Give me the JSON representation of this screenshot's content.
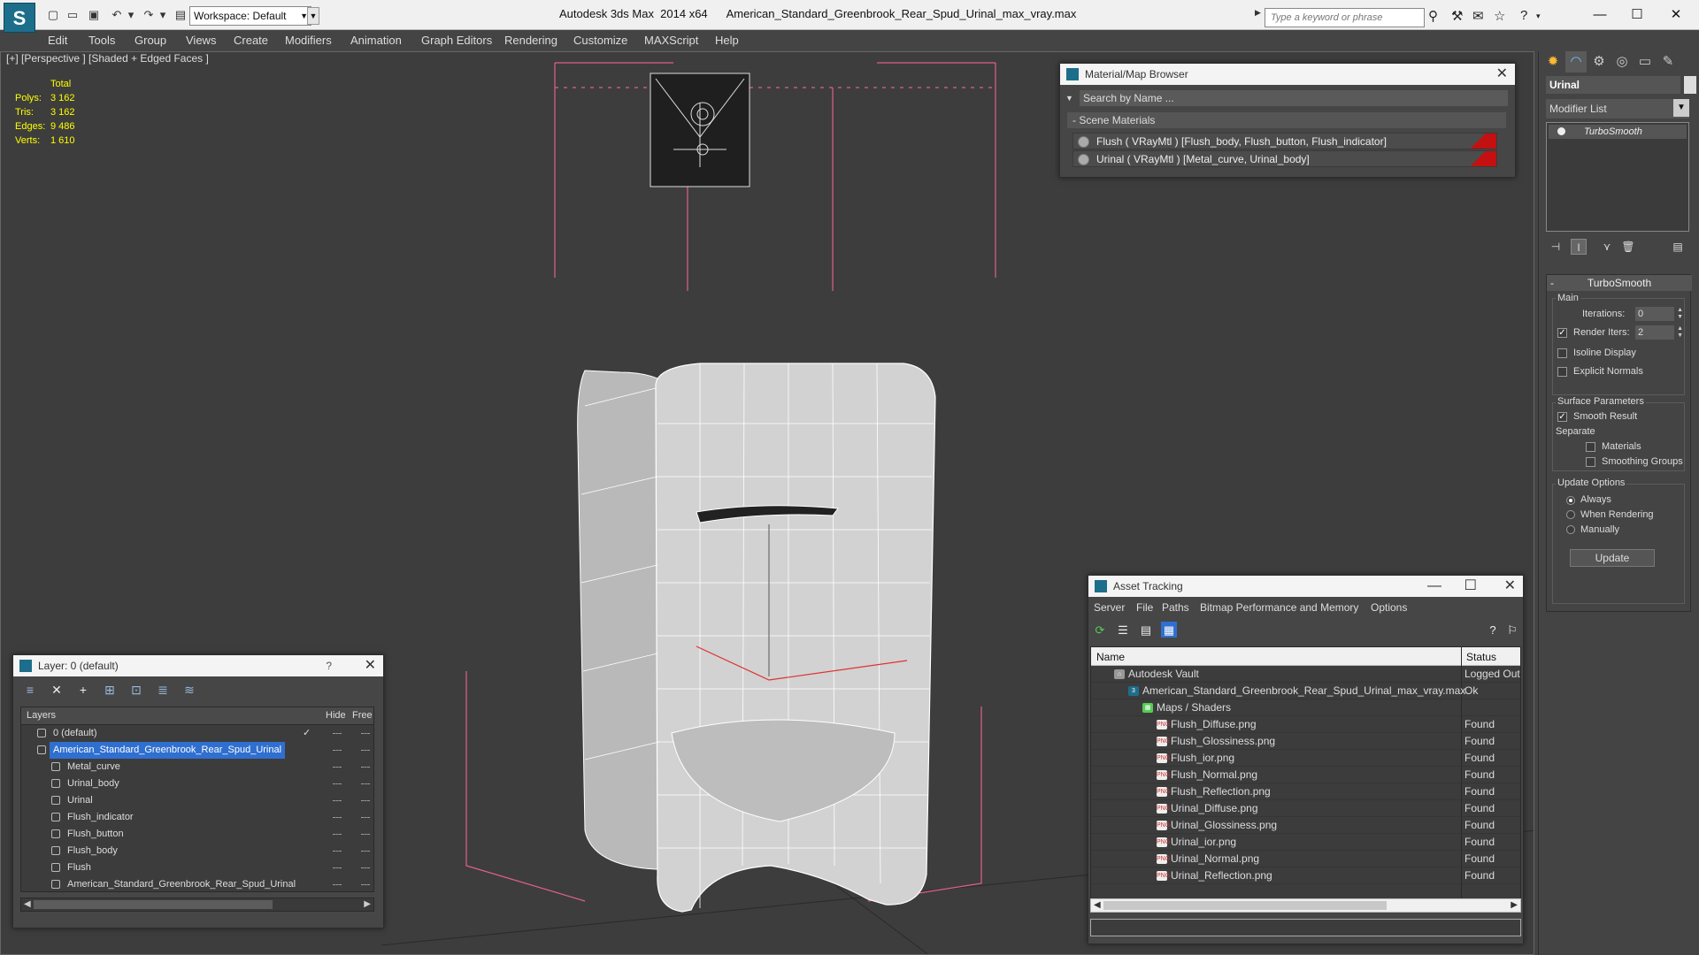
{
  "titlebar": {
    "app_title": "Autodesk 3ds Max  2014 x64      American_Standard_Greenbrook_Rear_Spud_Urinal_max_vray.max",
    "workspace": "Workspace: Default",
    "search_placeholder": "Type a keyword or phrase"
  },
  "menu": [
    "Edit",
    "Tools",
    "Group",
    "Views",
    "Create",
    "Modifiers",
    "Animation",
    "Graph Editors",
    "Rendering",
    "Customize",
    "MAXScript",
    "Help"
  ],
  "viewport": {
    "label": "[+] [Perspective ] [Shaded + Edged Faces ]",
    "stats": {
      "header": "Total",
      "rows": [
        {
          "label": "Polys:",
          "value": "3 162"
        },
        {
          "label": "Tris:",
          "value": "3 162"
        },
        {
          "label": "Edges:",
          "value": "9 486"
        },
        {
          "label": "Verts:",
          "value": "1 610"
        }
      ]
    },
    "colors": {
      "background": "#3d3d3d",
      "model": "#cfcfcf",
      "wire": "#ffffff",
      "bbox": "#e0608a",
      "selection_line": "#e03030"
    }
  },
  "material_browser": {
    "title": "Material/Map Browser",
    "search": "Search by Name ...",
    "section": "Scene Materials",
    "materials": [
      "Flush  ( VRayMtl ) [Flush_body, Flush_button, Flush_indicator]",
      "Urinal  ( VRayMtl ) [Metal_curve, Urinal_body]"
    ]
  },
  "layer_window": {
    "title": "Layer: 0 (default)",
    "help": "?",
    "columns": {
      "layers": "Layers",
      "hide": "Hide",
      "freeze": "Free"
    },
    "rows": [
      {
        "name": "0 (default)",
        "level": 0,
        "type": "layer",
        "selected": false
      },
      {
        "name": "American_Standard_Greenbrook_Rear_Spud_Urinal",
        "level": 0,
        "type": "layer",
        "selected": true
      },
      {
        "name": "Metal_curve",
        "level": 1,
        "type": "object",
        "selected": false
      },
      {
        "name": "Urinal_body",
        "level": 1,
        "type": "object",
        "selected": false
      },
      {
        "name": "Urinal",
        "level": 1,
        "type": "object",
        "selected": false
      },
      {
        "name": "Flush_indicator",
        "level": 1,
        "type": "object",
        "selected": false
      },
      {
        "name": "Flush_button",
        "level": 1,
        "type": "object",
        "selected": false
      },
      {
        "name": "Flush_body",
        "level": 1,
        "type": "object",
        "selected": false
      },
      {
        "name": "Flush",
        "level": 1,
        "type": "object",
        "selected": false
      },
      {
        "name": "American_Standard_Greenbrook_Rear_Spud_Urinal",
        "level": 1,
        "type": "object",
        "selected": false
      }
    ]
  },
  "asset_tracking": {
    "title": "Asset Tracking",
    "menu": [
      "Server",
      "File",
      "Paths",
      "Bitmap Performance and Memory",
      "Options"
    ],
    "columns": {
      "name": "Name",
      "status": "Status"
    },
    "rows": [
      {
        "name": "Autodesk Vault",
        "status": "Logged Out",
        "level": 1,
        "icon": "vault"
      },
      {
        "name": "American_Standard_Greenbrook_Rear_Spud_Urinal_max_vray.max",
        "status": "Ok",
        "level": 2,
        "icon": "max"
      },
      {
        "name": "Maps / Shaders",
        "status": "",
        "level": 3,
        "icon": "maps"
      },
      {
        "name": "Flush_Diffuse.png",
        "status": "Found",
        "level": 4,
        "icon": "png"
      },
      {
        "name": "Flush_Glossiness.png",
        "status": "Found",
        "level": 4,
        "icon": "png"
      },
      {
        "name": "Flush_ior.png",
        "status": "Found",
        "level": 4,
        "icon": "png"
      },
      {
        "name": "Flush_Normal.png",
        "status": "Found",
        "level": 4,
        "icon": "png"
      },
      {
        "name": "Flush_Reflection.png",
        "status": "Found",
        "level": 4,
        "icon": "png"
      },
      {
        "name": "Urinal_Diffuse.png",
        "status": "Found",
        "level": 4,
        "icon": "png"
      },
      {
        "name": "Urinal_Glossiness.png",
        "status": "Found",
        "level": 4,
        "icon": "png"
      },
      {
        "name": "Urinal_ior.png",
        "status": "Found",
        "level": 4,
        "icon": "png"
      },
      {
        "name": "Urinal_Normal.png",
        "status": "Found",
        "level": 4,
        "icon": "png"
      },
      {
        "name": "Urinal_Reflection.png",
        "status": "Found",
        "level": 4,
        "icon": "png"
      }
    ]
  },
  "command_panel": {
    "object_name": "Urinal",
    "modifier_list": "Modifier List",
    "stack_item": "TurboSmooth",
    "rollout_title": "TurboSmooth",
    "main_group": "Main",
    "iterations_label": "Iterations:",
    "iterations_value": "0",
    "render_iters_label": "Render Iters:",
    "render_iters_value": "2",
    "render_iters_checked": true,
    "isoline_label": "Isoline Display",
    "isoline_checked": false,
    "explicit_normals_label": "Explicit Normals",
    "explicit_normals_checked": false,
    "surface_group": "Surface Parameters",
    "smooth_result_label": "Smooth Result",
    "smooth_result_checked": true,
    "separate_label": "Separate",
    "materials_label": "Materials",
    "materials_checked": false,
    "smoothing_groups_label": "Smoothing Groups",
    "smoothing_groups_checked": false,
    "update_group": "Update Options",
    "update_options": [
      {
        "label": "Always",
        "selected": true
      },
      {
        "label": "When Rendering",
        "selected": false
      },
      {
        "label": "Manually",
        "selected": false
      }
    ],
    "update_button": "Update"
  }
}
